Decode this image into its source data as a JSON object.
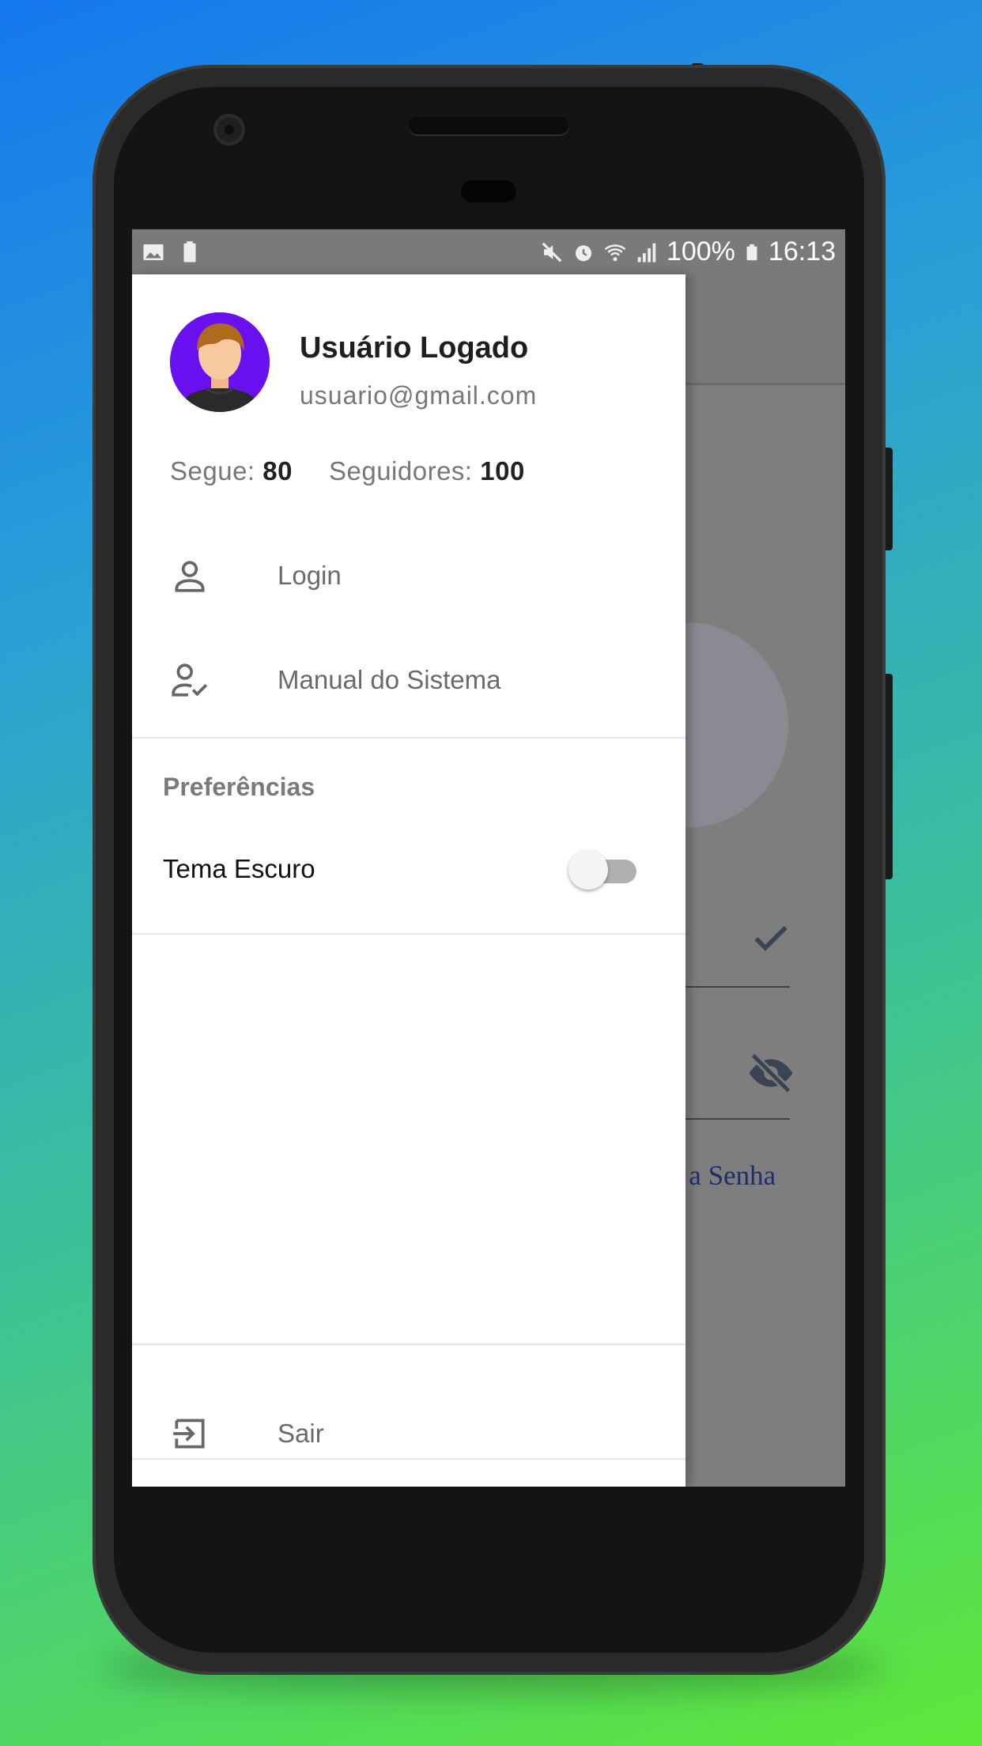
{
  "statusbar": {
    "battery": "100%",
    "time": "16:13"
  },
  "drawer": {
    "user_name": "Usuário Logado",
    "user_email": "usuario@gmail.com",
    "stats": {
      "following_label": "Segue:",
      "following_value": "80",
      "followers_label": "Seguidores:",
      "followers_value": "100"
    },
    "menu": [
      {
        "label": "Login",
        "icon": "person-icon"
      },
      {
        "label": "Manual do Sistema",
        "icon": "person-check-icon"
      }
    ],
    "preferences": {
      "title": "Preferências",
      "dark_theme_label": "Tema Escuro",
      "dark_theme_on": false
    },
    "logout_label": "Sair"
  },
  "background": {
    "forgot_password_fragment": "a a Senha"
  },
  "colors": {
    "avatar_bg": "#6a0ff0",
    "drawer_bg": "#ffffff",
    "scrim": "#7e7e7e"
  }
}
